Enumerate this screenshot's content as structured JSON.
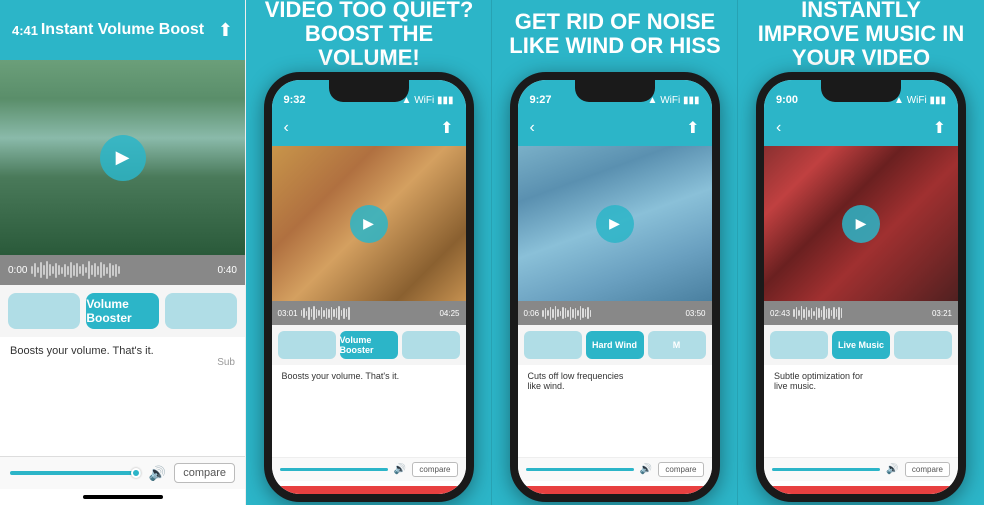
{
  "panel1": {
    "time": "4:41",
    "title": "Instant Volume\nBoost",
    "time_start": "0:00",
    "time_end": "0:40",
    "active_filter": "Volume Booster",
    "description": "Boosts your volume. That's it.",
    "sub_label": "Sub",
    "compare_label": "compare"
  },
  "panel2": {
    "header": "VIDEO TOO QUIET?\nBOOST THE VOLUME!",
    "time": "9:32",
    "time_start": "03:01",
    "time_end": "04:25",
    "active_filter": "Volume Booster",
    "description": "Boosts your volume. That's it.",
    "compare_label": "compare"
  },
  "panel3": {
    "header": "GET RID OF NOISE\nLIKE WIND OR HISS",
    "time": "9:27",
    "time_start": "0:06",
    "time_end": "03:50",
    "active_filter": "Hard Wind",
    "description": "Cuts off low frequencies\nlike wind.",
    "compare_label": "compare"
  },
  "panel4": {
    "header": "INSTANTLY IMPROVE\nMUSIC IN YOUR VIDEO",
    "time": "9:00",
    "time_start": "02:43",
    "time_end": "03:21",
    "active_filter": "Live Music",
    "description": "Subtle optimization for\nlive music.",
    "compare_label": "compare"
  }
}
